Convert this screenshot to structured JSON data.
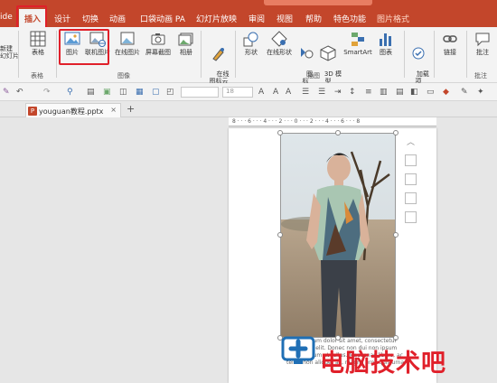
{
  "ribbon_tabs": [
    {
      "label": "ide"
    },
    {
      "label": "插入"
    },
    {
      "label": "设计"
    },
    {
      "label": "切换"
    },
    {
      "label": "动画"
    },
    {
      "label": "口袋动画 PA"
    },
    {
      "label": "幻灯片放映"
    },
    {
      "label": "审阅"
    },
    {
      "label": "视图"
    },
    {
      "label": "帮助"
    },
    {
      "label": "特色功能"
    },
    {
      "label": "图片格式"
    }
  ],
  "ribbon": {
    "new_slide": "新建\n幻灯片",
    "table": "表格",
    "picture": "图片",
    "online_picture_linked": "联机图片",
    "online_picture": "在线图片",
    "screenshot": "屏幕截图",
    "album": "相册",
    "online_icon_cloud": "在线\n图标云",
    "shapes": "形状",
    "online_shapes": "在线形状",
    "icons": "图\n标",
    "model3d": "3D 模\n型",
    "smartart": "SmartArt",
    "chart": "图表",
    "addins": "加载\n项",
    "link": "链接",
    "comment": "批注",
    "group_tables": "表格",
    "group_images": "图像",
    "group_illustrations": "插图",
    "group_comments": "批注"
  },
  "toolbar": {
    "font_size": "18"
  },
  "document": {
    "tab_name": "youguan教程.pptx",
    "close": "×",
    "add_tab": "+",
    "ruler_text": "8 · · · 6 · · · 4 · · · 2 · · · 0 · · · 2 · · · 4 · · · 6 · · · 8"
  },
  "slide_text": "Lorem ipsum dolor sit amet, consectetur adipiscing elit. Donec non dui non ipsum nulla, rutrum ut tellus. Maecenas libero, ac tellus non aliquet ac, magna eros quis urna.",
  "watermark": {
    "text": "电脑技术吧",
    "color": "#e0202a"
  },
  "colors": {
    "accent": "#c3462b",
    "highlight_box": "#e0202a"
  }
}
